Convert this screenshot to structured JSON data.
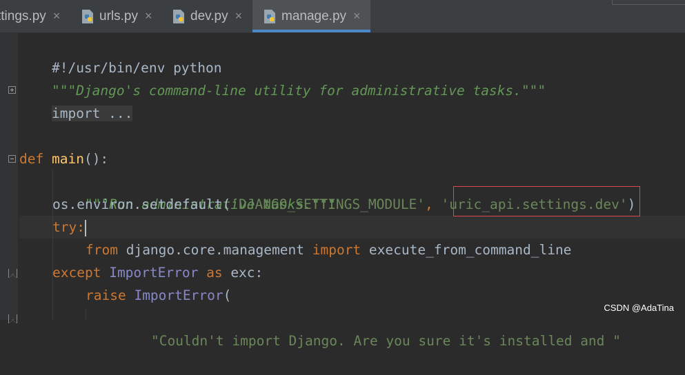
{
  "tabs": [
    {
      "label": "ttings.py",
      "close": "×",
      "active": false
    },
    {
      "label": "urls.py",
      "close": "×",
      "active": false
    },
    {
      "label": "dev.py",
      "close": "×",
      "active": false
    },
    {
      "label": "manage.py",
      "close": "×",
      "active": true
    }
  ],
  "code": {
    "l1": "#!/usr/bin/env python",
    "l2": "\"\"\"Django's command-line utility for administrative tasks.\"\"\"",
    "l3": "import ...",
    "l6_kw": "def",
    "l6_fn": "main",
    "l6_rest": "():",
    "l7": "\"\"\"Run administrative tasks.\"\"\"",
    "l8_a": "os.environ.setdefault(",
    "l8_s1": "'DJANGO_SETTINGS_MODULE'",
    "l8_b": ", ",
    "l8_s2": "'uric_api.settings.dev'",
    "l8_c": ")",
    "l9_kw": "try",
    "l9_rest": ":",
    "l10_kw1": "from",
    "l10_mod": " django.core.management ",
    "l10_kw2": "import",
    "l10_rest": " execute_from_command_line",
    "l11_kw": "except",
    "l11_cls": "ImportError",
    "l11_kw2": "as",
    "l11_rest": " exc:",
    "l12_kw": "raise",
    "l12_cls": "ImportError",
    "l12_rest": "(",
    "l13": "\"Couldn't import Django. Are you sure it's installed and \""
  },
  "watermark": "CSDN @AdaTina",
  "colors": {
    "background": "#2b2b2b",
    "keyword": "#cc7832",
    "function": "#ffc66d",
    "string": "#6a8759",
    "docstring": "#629755",
    "highlight_box": "#e0484a"
  }
}
